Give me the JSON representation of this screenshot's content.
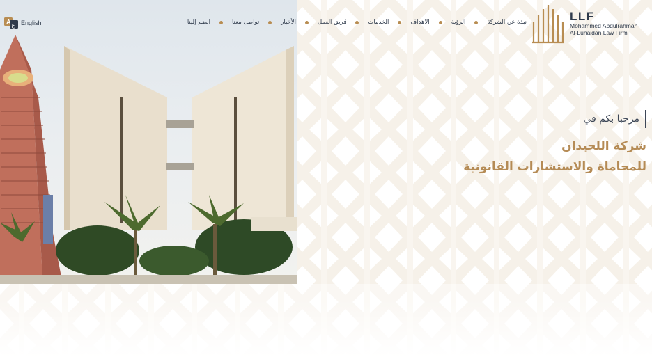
{
  "header": {
    "language_label": "English",
    "language_icon": "translate-icon",
    "nav_items": [
      {
        "label": "نبذة عن الشركة"
      },
      {
        "label": "الرؤية"
      },
      {
        "label": "الاهداف"
      },
      {
        "label": "الخدمات"
      },
      {
        "label": "فريق العمل"
      },
      {
        "label": "الأخبار"
      },
      {
        "label": "تواصل معنا"
      },
      {
        "label": "انضم إلينا"
      }
    ]
  },
  "logo": {
    "abbr": "LLF",
    "line1": "Mohammed Abdulrahman",
    "line2": "Al-Luhaidan Law Firm"
  },
  "hero": {
    "welcome": "مرحبا بكم في",
    "title_line1": "شركة اللحيدان",
    "title_line2": "للمحاماة والاستشارات القانونية"
  },
  "colors": {
    "gold": "#b88d52",
    "navy": "#2f3b4c"
  }
}
